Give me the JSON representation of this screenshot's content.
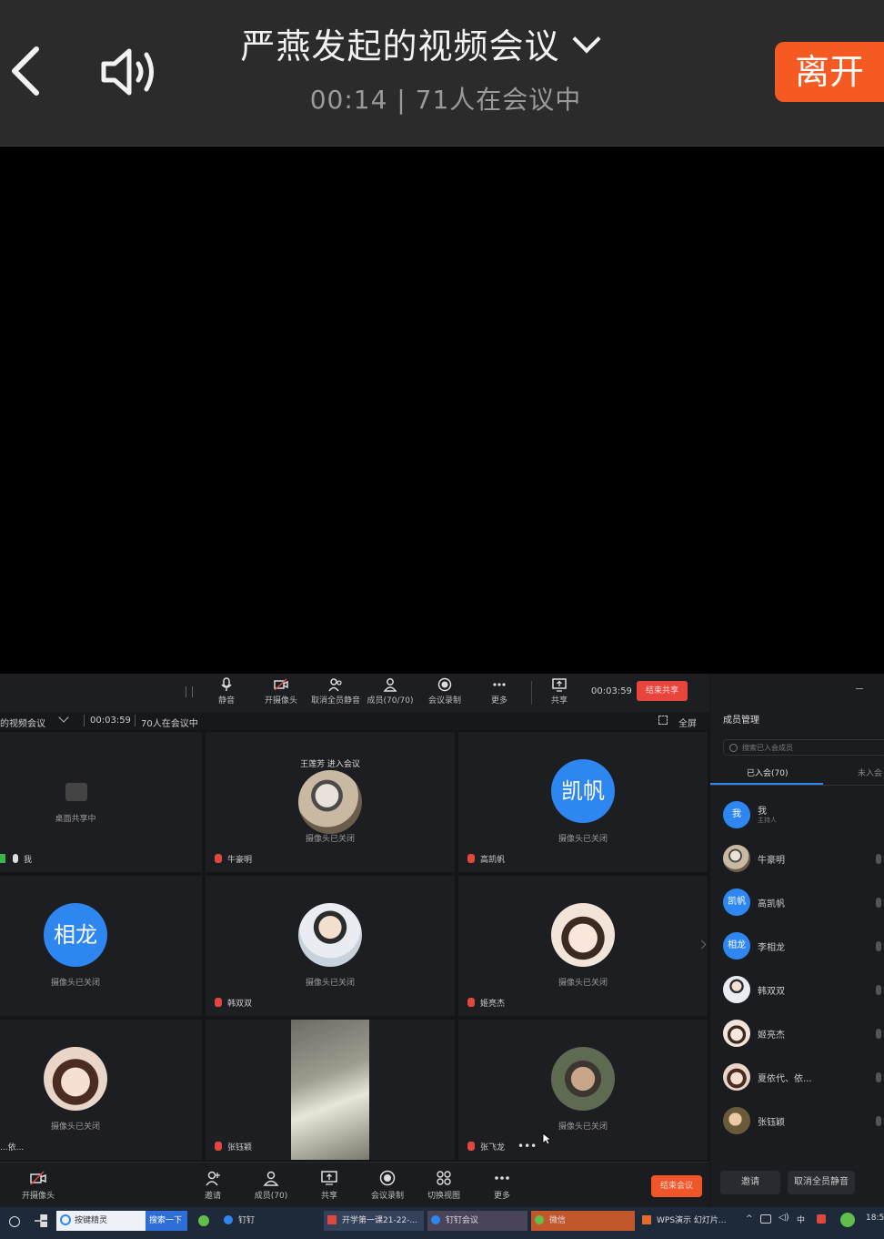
{
  "phone": {
    "title": "严燕发起的视频会议",
    "subtitle": "00:14 | 71人在会议中",
    "leave_label": "离开"
  },
  "toolbar": {
    "items": [
      {
        "label": "静音",
        "icon": "mic-icon"
      },
      {
        "label": "开摄像头",
        "icon": "camera-off-icon"
      },
      {
        "label": "取消全员静音",
        "icon": "members-mute-icon"
      },
      {
        "label": "成员(70/70)",
        "icon": "members-icon"
      },
      {
        "label": "会议录制",
        "icon": "record-icon"
      },
      {
        "label": "更多",
        "icon": "more-icon"
      },
      {
        "label": "共享",
        "icon": "share-icon"
      }
    ],
    "timer": "00:03:59",
    "end_share_label": "结束共享"
  },
  "infobar": {
    "title": "的视频会议",
    "timer": "00:03:59",
    "count": "70人在会议中",
    "fullscreen": "全屏"
  },
  "tiles": [
    {
      "caption": "桌面共享中",
      "name": "我"
    },
    {
      "notice": "王莲芳 进入会议",
      "caption": "摄像头已关闭",
      "name": "牛豪明"
    },
    {
      "avatar_text": "凯帆",
      "caption": "摄像头已关闭",
      "name": "高凯帆"
    },
    {
      "avatar_text": "相龙",
      "caption": "摄像头已关闭",
      "name": ""
    },
    {
      "caption": "摄像头已关闭",
      "name": "韩双双"
    },
    {
      "caption": "摄像头已关闭",
      "name": "姬亮杰"
    },
    {
      "caption": "摄像头已关闭",
      "name": "...依..."
    },
    {
      "caption": "",
      "name": "张钰颖"
    },
    {
      "caption": "摄像头已关闭",
      "name": "张飞龙"
    }
  ],
  "sidebar": {
    "title": "成员管理",
    "search_placeholder": "搜索已入会成员",
    "tab_joined": "已入会(70)",
    "tab_not_joined": "未入会",
    "members": [
      {
        "name": "我",
        "sub": "主持人",
        "avatar": "我"
      },
      {
        "name": "牛豪明",
        "sub": "",
        "avatar": ""
      },
      {
        "name": "高凯帆",
        "sub": "",
        "avatar": "凯帆"
      },
      {
        "name": "李相龙",
        "sub": "",
        "avatar": "相龙"
      },
      {
        "name": "韩双双",
        "sub": "",
        "avatar": ""
      },
      {
        "name": "姬亮杰",
        "sub": "",
        "avatar": ""
      },
      {
        "name": "夏依代、依...",
        "sub": "",
        "avatar": ""
      },
      {
        "name": "张钰颖",
        "sub": "",
        "avatar": ""
      }
    ],
    "invite": "邀请",
    "unmute_all": "取消全员静音"
  },
  "bottombar": {
    "camera": "开摄像头",
    "items": [
      "邀请",
      "成员(70)",
      "共享",
      "会议录制",
      "切换视图",
      "更多"
    ],
    "end_meeting": "结束会议"
  },
  "taskbar": {
    "items": [
      "按键精灵",
      "搜索一下",
      "钉钉",
      "开学第一课21-22-...",
      "钉钉会议",
      "微信",
      "WPS演示 幻灯片..."
    ],
    "ime": "中",
    "clock": "18:5"
  },
  "colors": {
    "accent": "#f55a23",
    "avatar_blue": "#2e86f0",
    "mute_red": "#e0483f"
  }
}
